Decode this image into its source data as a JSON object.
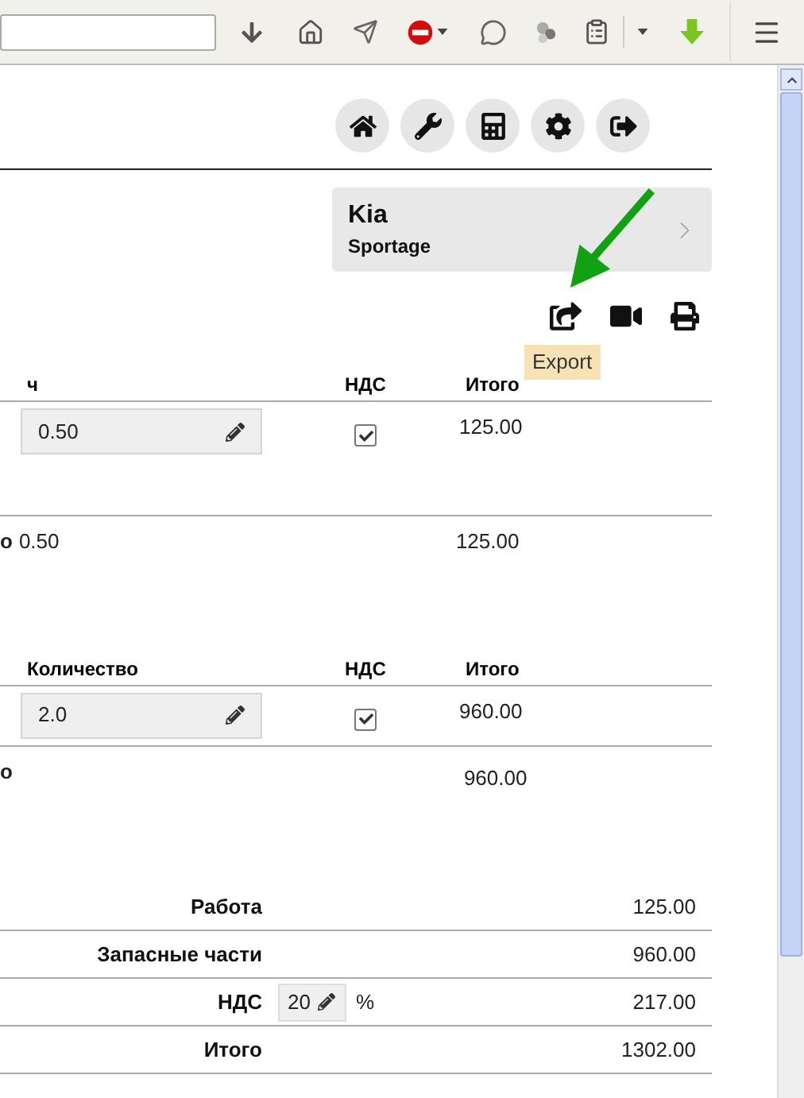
{
  "car": {
    "make": "Kia",
    "model": "Sportage"
  },
  "tooltip": "Export",
  "labor": {
    "columns": [
      "ч",
      "НДС",
      "Итого"
    ],
    "rows": [
      {
        "hours": "0.50",
        "vat": true,
        "total": "125.00"
      }
    ],
    "total": {
      "label": "о",
      "hours": "0.50",
      "sum": "125.00"
    }
  },
  "parts": {
    "columns": [
      "Количество",
      "НДС",
      "Итого"
    ],
    "rows": [
      {
        "qty": "2.0",
        "vat": true,
        "total": "960.00"
      }
    ],
    "total": {
      "label": "о",
      "sum": "960.00"
    }
  },
  "summary": [
    {
      "kind": "plain",
      "label": "Работа",
      "value": "125.00"
    },
    {
      "kind": "plain",
      "label": "Запасные части",
      "value": "960.00"
    },
    {
      "kind": "rate",
      "label": "НДС",
      "field": "20",
      "unit": "%",
      "value": "217.00"
    },
    {
      "kind": "plain",
      "label": "Итого",
      "value": "1302.00"
    }
  ]
}
